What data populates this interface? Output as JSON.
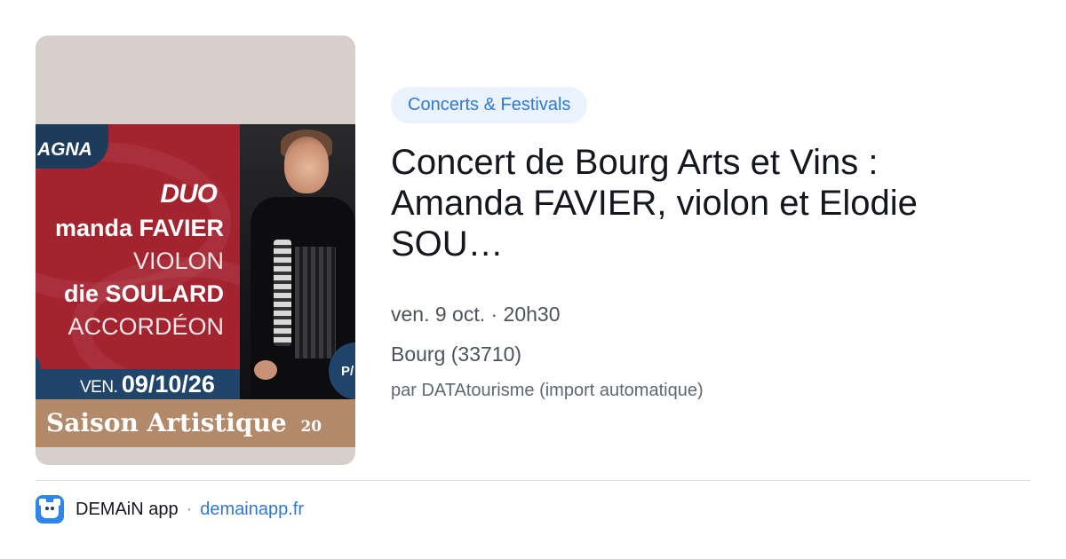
{
  "poster": {
    "corner_tag": "AGNA",
    "duo": "DUO",
    "line1": "manda FAVIER",
    "line2": "VIOLON",
    "line3": "die SOULARD",
    "line4": "ACCORDÉON",
    "date_prefix": "VEN.",
    "date_value": "09/10/26",
    "badge_text": "P/",
    "saison": "Saison Artistique",
    "saison_year": "20"
  },
  "event": {
    "category": "Concerts & Festivals",
    "title": "Concert de Bourg Arts et Vins : Amanda FAVIER, violon et Elodie SOU…",
    "datetime": "ven. 9 oct. · 20h30",
    "location": "Bourg (33710)",
    "source": "par DATAtourisme (import automatique)"
  },
  "footer": {
    "app_name": "DEMAiN app",
    "separator": "·",
    "link": "demainapp.fr"
  },
  "colors": {
    "accent": "#2f78d4",
    "category_bg": "#eaf3fd",
    "poster_red": "#a3232f",
    "poster_blue": "#21456a",
    "poster_tan": "#b28a6a"
  }
}
